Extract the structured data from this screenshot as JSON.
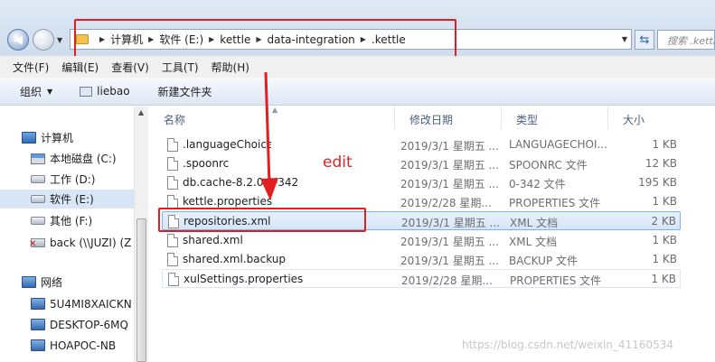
{
  "navigation": {
    "back": "◀",
    "forward": "▶"
  },
  "address": {
    "crumbs": [
      "计算机",
      "软件 (E:)",
      "kettle",
      "data-integration",
      ".kettle"
    ]
  },
  "search": {
    "placeholder": "搜索 .kettle"
  },
  "menubar": [
    "文件(F)",
    "编辑(E)",
    "查看(V)",
    "工具(T)",
    "帮助(H)"
  ],
  "toolbar": {
    "organize": "组织",
    "liebao": "liebao",
    "new_folder": "新建文件夹"
  },
  "sidebar": {
    "computer": "计算机",
    "drives": [
      "本地磁盘 (C:)",
      "工作 (D:)",
      "软件 (E:)",
      "其他 (F:)",
      "back (\\\\JUZI) (Z"
    ],
    "network": "网络",
    "hosts": [
      "5U4MI8XAICKN",
      "DESKTOP-6MQ",
      "HOAPOC-NB"
    ]
  },
  "columns": {
    "name": "名称",
    "date": "修改日期",
    "type": "类型",
    "size": "大小"
  },
  "files": [
    {
      "name": ".languageChoice",
      "date": "2019/3/1 星期五 ...",
      "type": "LANGUAGECHOI...",
      "size": "1 KB"
    },
    {
      "name": ".spoonrc",
      "date": "2019/3/1 星期五 ...",
      "type": "SPOONRC 文件",
      "size": "12 KB"
    },
    {
      "name": "db.cache-8.2.0.0-342",
      "date": "2019/3/1 星期五 ...",
      "type": "0-342 文件",
      "size": "195 KB"
    },
    {
      "name": "kettle.properties",
      "date": "2019/2/28 星期...",
      "type": "PROPERTIES 文件",
      "size": "1 KB"
    },
    {
      "name": "repositories.xml",
      "date": "2019/3/1 星期五 ...",
      "type": "XML 文档",
      "size": "2 KB"
    },
    {
      "name": "shared.xml",
      "date": "2019/3/1 星期五 ...",
      "type": "XML 文档",
      "size": "1 KB"
    },
    {
      "name": "shared.xml.backup",
      "date": "2019/3/1 星期五 ...",
      "type": "BACKUP 文件",
      "size": "1 KB"
    },
    {
      "name": "xulSettings.properties",
      "date": "2019/2/28 星期...",
      "type": "PROPERTIES 文件",
      "size": "1 KB"
    }
  ],
  "annotation": {
    "edit": "edit"
  },
  "watermark": "https://blog.csdn.net/weixin_41160534",
  "colors": {
    "highlight": "#e02020",
    "selection": "#d4e5f8"
  }
}
